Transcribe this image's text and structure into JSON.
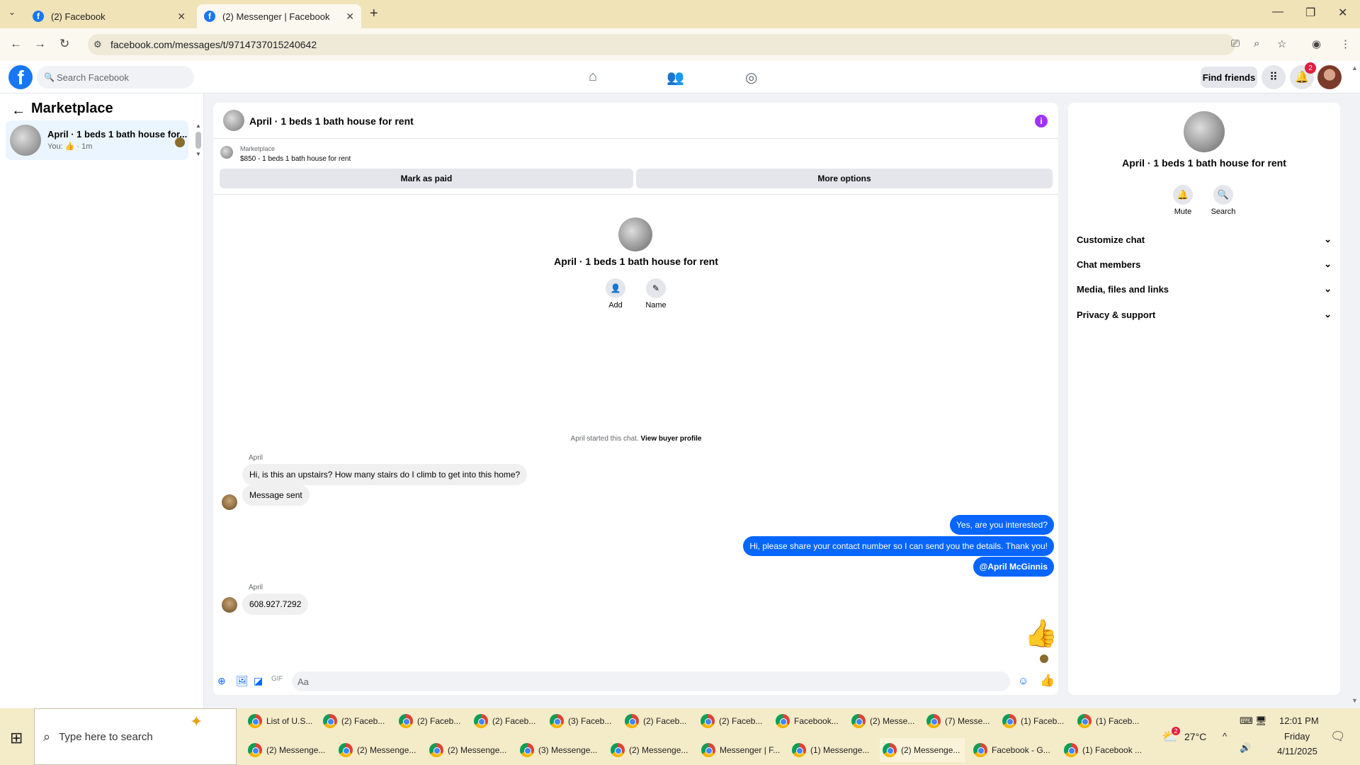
{
  "browser": {
    "tabs": [
      {
        "label": "(2) Facebook",
        "active": false
      },
      {
        "label": "(2) Messenger | Facebook",
        "active": true
      }
    ],
    "url": "facebook.com/messages/t/9714737015240642",
    "new_tab_label": "+",
    "close_label": "✕"
  },
  "fb": {
    "search_placeholder": "Search Facebook",
    "find_friends": "Find friends",
    "notification_count": "2",
    "logo": "f"
  },
  "left": {
    "title": "Marketplace",
    "conversation": {
      "name": "April · 1 beds 1 bath house for...",
      "sub": "You: 👍 · 1m"
    }
  },
  "chat": {
    "title": "April · 1 beds 1 bath house for rent",
    "listing_source": "Marketplace",
    "listing_price": "$850 - 1 beds 1 bath house for rent",
    "mark_paid": "Mark as paid",
    "more_options": "More options",
    "center_title": "April · 1 beds 1 bath house for rent",
    "add_label": "Add",
    "name_label": "Name",
    "started_text": "April started this chat.",
    "view_profile": "View buyer profile",
    "messages": [
      {
        "sender": "April",
        "text": "Hi, is this an upstairs? How many stairs do I climb to get into this home?"
      },
      {
        "text": "Message sent"
      },
      {
        "out": true,
        "text": "Yes, are you interested?"
      },
      {
        "out": true,
        "text": "Hi, please share your contact number so I can send you the details. Thank you!"
      },
      {
        "out": true,
        "text": "@April McGinnis"
      },
      {
        "sender": "April",
        "text": "608.927.7292"
      }
    ],
    "composer_placeholder": "Aa"
  },
  "right": {
    "title": "April · 1 beds 1 bath house for rent",
    "mute": "Mute",
    "search": "Search",
    "sections": [
      "Customize chat",
      "Chat members",
      "Media, files and links",
      "Privacy & support"
    ]
  },
  "taskbar": {
    "search_placeholder": "Type here to search",
    "row1": [
      "List of U.S...",
      "(2) Faceb...",
      "(2) Faceb...",
      "(2) Faceb...",
      "(3) Faceb...",
      "(2) Faceb...",
      "(2) Faceb...",
      "Facebook...",
      "(2) Messe...",
      "(7) Messe...",
      "(1) Faceb...",
      "(1) Faceb..."
    ],
    "row2": [
      "(2) Messenge...",
      "(2) Messenge...",
      "(2) Messenge...",
      "(3) Messenge...",
      "(2) Messenge...",
      "Messenger | F...",
      "(1) Messenge...",
      "(2) Messenge...",
      "Facebook - G...",
      "(1) Facebook ..."
    ],
    "weather": "27°C",
    "weather_badge": "2",
    "time": "12:01 PM",
    "day": "Friday",
    "date": "4/11/2025"
  },
  "colors": {
    "accent": "#0866ff",
    "fb_blue": "#1877f2",
    "info_purple": "#a033ff",
    "tab_bar": "#f0e3b8"
  }
}
